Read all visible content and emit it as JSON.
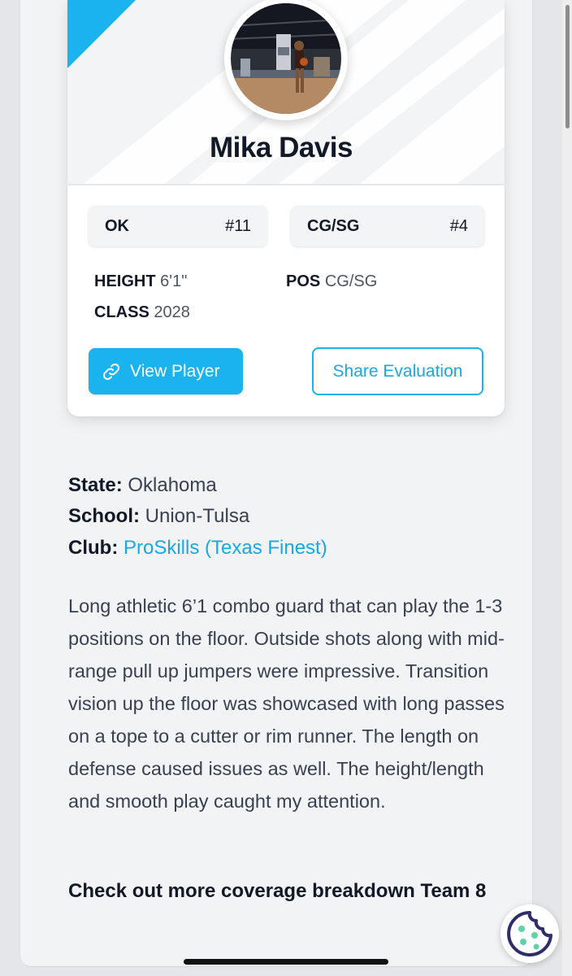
{
  "player": {
    "name": "Mika Davis",
    "photo_alt": "Player photo"
  },
  "badges": [
    {
      "left": "OK",
      "right": "#11"
    },
    {
      "left": "CG/SG",
      "right": "#4"
    }
  ],
  "stats": {
    "height": {
      "label": "HEIGHT",
      "value": "6'1\""
    },
    "position": {
      "label": "POS",
      "value": "CG/SG"
    },
    "class": {
      "label": "CLASS",
      "value": "2028"
    }
  },
  "buttons": {
    "view_player": "View Player",
    "share_evaluation": "Share Evaluation"
  },
  "info": {
    "state": {
      "label": "State:",
      "value": "Oklahoma"
    },
    "school": {
      "label": "School:",
      "value": "Union-Tulsa"
    },
    "club": {
      "label": "Club:",
      "value": "ProSkills (Texas Finest)"
    }
  },
  "description": "Long athletic 6’1 combo guard that can play the 1-3 positions on the floor. Outside shots along with mid-range pull up jumpers were impressive. Transition vision up the floor was showcased with long passes on a tope to a cutter or rim runner. The length on defense caused issues as well. The height/length and smooth play caught my attention.",
  "coverage": "Check out more coverage breakdown Team 8",
  "icons": {
    "link": "link-icon",
    "cookie": "cookie-icon"
  },
  "colors": {
    "accent": "#1ab3f0",
    "link": "#1aa8e3",
    "cookie": "#2e2d6b",
    "cookie_dots": "#5fd3a8"
  }
}
